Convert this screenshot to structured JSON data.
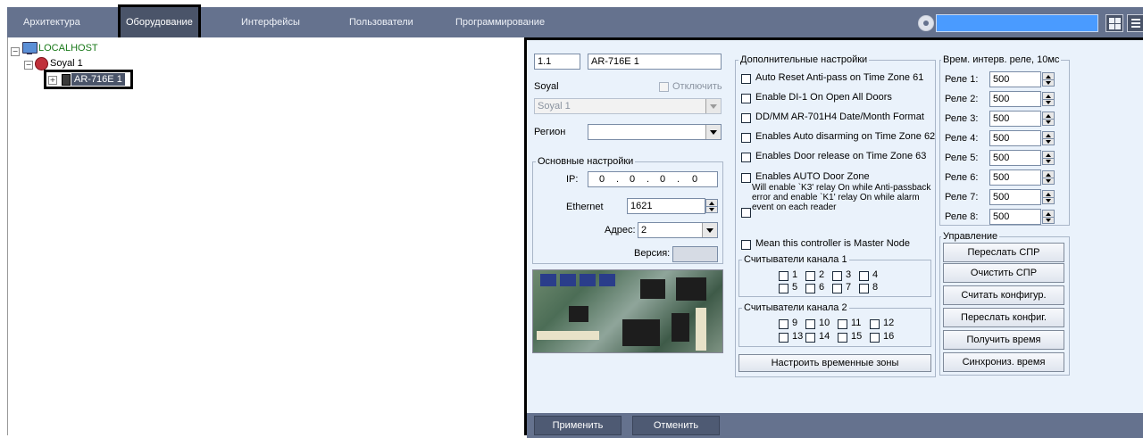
{
  "tabs": [
    "Архитектура",
    "Оборудование",
    "Интерфейсы",
    "Пользователи",
    "Программирование"
  ],
  "active_tab": "Оборудование",
  "tree": {
    "root": "LOCALHOST",
    "child": "Soyal 1",
    "device": "AR-716E 1"
  },
  "device": {
    "number": "1.1",
    "name": "AR-716E 1",
    "parent_label": "Soyal",
    "disable_label": "Отключить",
    "parent_select": "Soyal 1",
    "region_label": "Регион",
    "region_value": ""
  },
  "basic": {
    "title": "Основные настройки",
    "ip_label": "IP:",
    "ip": [
      "0",
      "0",
      "0",
      "0"
    ],
    "ethernet_label": "Ethernet",
    "ethernet_port": "1621",
    "address_label": "Адрес:",
    "address": "2",
    "version_label": "Версия:",
    "version": ""
  },
  "extra": {
    "title": "Дополнительные настройки",
    "options": [
      "Auto Reset Anti-pass on Time Zone 61",
      "Enable DI-1 On Open All Doors",
      "DD/MM AR-701H4 Date/Month Format",
      "Enables Auto disarming on Time Zone 62",
      "Enables Door release on Time Zone 63",
      "Enables AUTO Door  Zone",
      "Will enable `K3' relay On while Anti-passback error and enable `K1' relay On while alarm event on each reader",
      "Mean this controller is Master Node"
    ],
    "readers1_title": "Считыватели канала 1",
    "readers1": [
      "1",
      "2",
      "3",
      "4",
      "5",
      "6",
      "7",
      "8"
    ],
    "readers2_title": "Считыватели канала 2",
    "readers2": [
      "9",
      "10",
      "11",
      "12",
      "13",
      "14",
      "15",
      "16"
    ],
    "timezones_button": "Настроить временные зоны"
  },
  "relays": {
    "title": "Врем. интерв. реле, 10мс",
    "items": [
      {
        "label": "Реле 1:",
        "value": "500"
      },
      {
        "label": "Реле 2:",
        "value": "500"
      },
      {
        "label": "Реле 3:",
        "value": "500"
      },
      {
        "label": "Реле 4:",
        "value": "500"
      },
      {
        "label": "Реле 5:",
        "value": "500"
      },
      {
        "label": "Реле 6:",
        "value": "500"
      },
      {
        "label": "Реле 7:",
        "value": "500"
      },
      {
        "label": "Реле 8:",
        "value": "500"
      }
    ]
  },
  "control": {
    "title": "Управление",
    "buttons": [
      "Переслать СПР",
      "Очистить СПР",
      "Считать конфигур.",
      "Переслать конфиг.",
      "Получить время",
      "Синхрониз. время"
    ]
  },
  "footer": {
    "apply": "Применить",
    "cancel": "Отменить"
  },
  "colors": {
    "tabstrip": "#65728e",
    "panel_bg": "#eaf2fb",
    "search_field": "#4a9bff",
    "tree_root_text": "#1a7a1a"
  },
  "icons": [
    "settings-icon",
    "grid-view-icon",
    "menu-icon",
    "computer-icon",
    "soyal-icon",
    "controller-icon"
  ]
}
